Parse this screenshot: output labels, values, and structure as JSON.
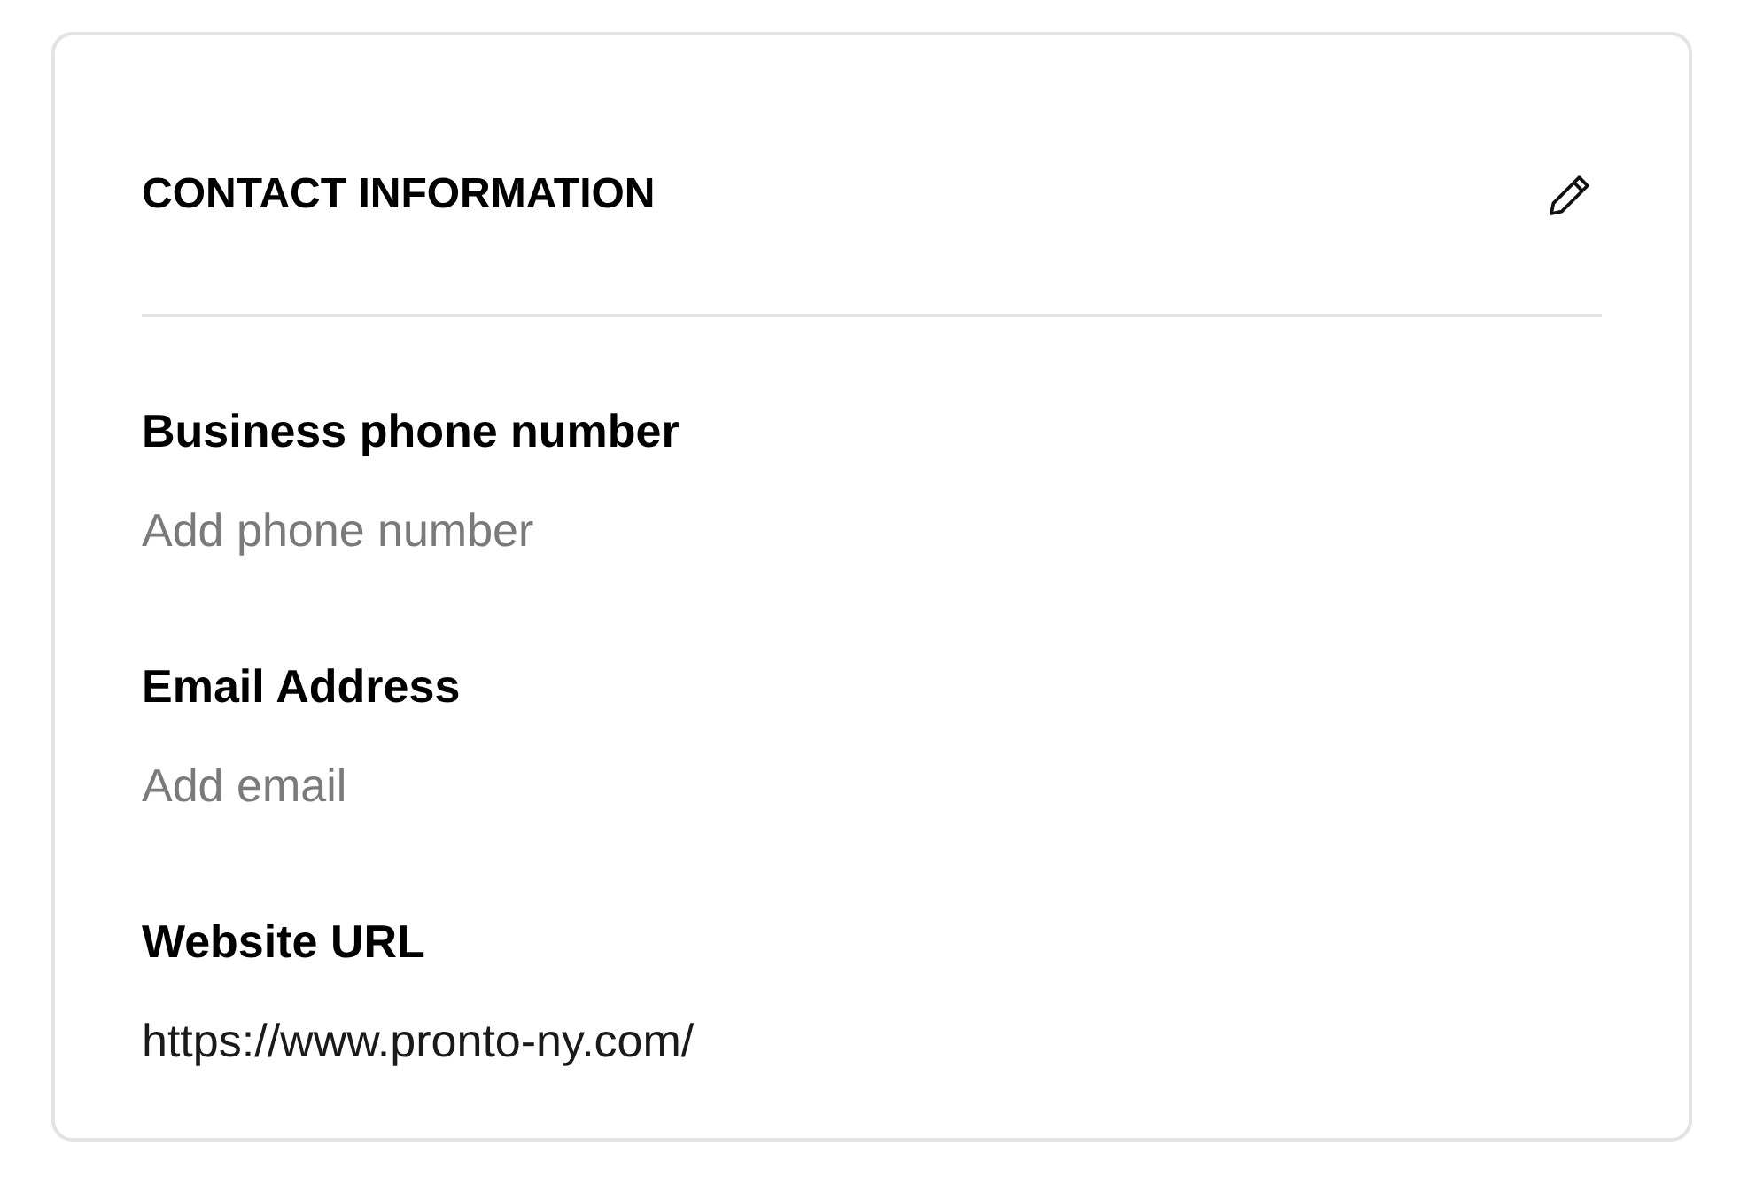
{
  "card": {
    "title": "CONTACT INFORMATION"
  },
  "fields": [
    {
      "label": "Business phone number",
      "text": "Add phone number",
      "kind": "placeholder"
    },
    {
      "label": "Email Address",
      "text": "Add email",
      "kind": "placeholder"
    },
    {
      "label": "Website URL",
      "text": "https://www.pronto-ny.com/",
      "kind": "value"
    }
  ]
}
